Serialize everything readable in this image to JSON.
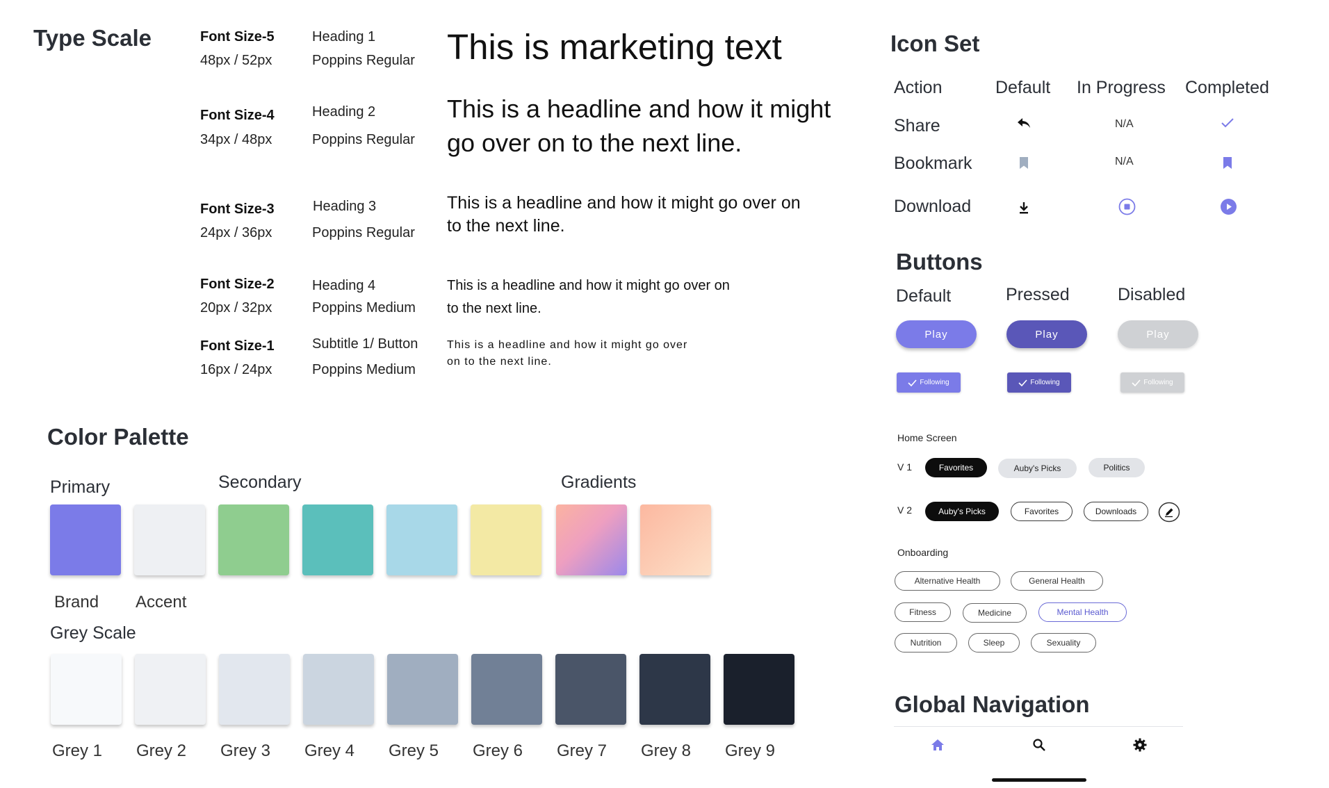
{
  "type_scale": {
    "title": "Type Scale",
    "rows": [
      {
        "size_name": "Font Size-5",
        "size_val": "48px / 52px",
        "heading": "Heading 1",
        "font": "Poppins Regular",
        "sample": "This is marketing text"
      },
      {
        "size_name": "Font Size-4",
        "size_val": "34px / 48px",
        "heading": "Heading 2",
        "font": "Poppins Regular",
        "sample": "This is a headline and how it might go over on to the next line."
      },
      {
        "size_name": "Font Size-3",
        "size_val": "24px / 36px",
        "heading": "Heading 3",
        "font": "Poppins Regular",
        "sample": "This is a headline and how it might go over on to the next line."
      },
      {
        "size_name": "Font Size-2",
        "size_val": "20px / 32px",
        "heading": "Heading 4",
        "font": "Poppins Medium",
        "sample": "This is a headline and how it might go over on to the next line."
      },
      {
        "size_name": "Font Size-1",
        "size_val": "16px / 24px",
        "heading": "Subtitle 1/ Button",
        "font": "Poppins Medium",
        "sample": "This is a headline and how it might go over on to the next line."
      }
    ]
  },
  "color_palette": {
    "title": "Color Palette",
    "primary_title": "Primary",
    "secondary_title": "Secondary",
    "gradients_title": "Gradients",
    "brand_label": "Brand",
    "accent_label": "Accent",
    "colors": {
      "brand": "#7b7be8",
      "accent": "#eef0f3",
      "secondary": [
        "#8fcd8f",
        "#5bbfbb",
        "#a8d8e8",
        "#f3e9a4"
      ],
      "gradient_1": [
        "#fbb3a1",
        "#9b88ea"
      ],
      "gradient_2": [
        "#fcb8a0",
        "#fde0c8"
      ]
    },
    "grey_title": "Grey Scale",
    "greys": [
      {
        "label": "Grey 1",
        "color": "#f7f9fb"
      },
      {
        "label": "Grey 2",
        "color": "#eff1f4"
      },
      {
        "label": "Grey 3",
        "color": "#e2e7ee"
      },
      {
        "label": "Grey 4",
        "color": "#cbd5e0"
      },
      {
        "label": "Grey 5",
        "color": "#a0aec0"
      },
      {
        "label": "Grey 6",
        "color": "#718096"
      },
      {
        "label": "Grey 7",
        "color": "#4a5568"
      },
      {
        "label": "Grey 8",
        "color": "#2d3748"
      },
      {
        "label": "Grey 9",
        "color": "#1a202c"
      }
    ]
  },
  "icon_set": {
    "title": "Icon Set",
    "headers": [
      "Action",
      "Default",
      "In Progress",
      "Completed"
    ],
    "rows": [
      {
        "action": "Share",
        "default_icon": "reply-arrow-icon",
        "in_progress": "N/A",
        "completed_icon": "checkmark-icon"
      },
      {
        "action": "Bookmark",
        "default_icon": "bookmark-icon",
        "in_progress": "N/A",
        "completed_icon": "bookmark-filled-icon"
      },
      {
        "action": "Download",
        "default_icon": "download-icon",
        "in_progress_icon": "stop-circle-icon",
        "completed_icon": "play-circle-icon"
      }
    ]
  },
  "buttons": {
    "title": "Buttons",
    "states": [
      "Default",
      "Pressed",
      "Disabled"
    ],
    "play_label": "Play",
    "following_label": "Following",
    "colors": {
      "default": "#7b7be8",
      "pressed": "#5a57b8",
      "disabled": "#cfd1d4"
    }
  },
  "home_screen": {
    "title": "Home Screen",
    "v1_label": "V 1",
    "v1_chips": [
      "Favorites",
      "Auby's Picks",
      "Politics"
    ],
    "v2_label": "V 2",
    "v2_chips": [
      "Auby's Picks",
      "Favorites",
      "Downloads"
    ],
    "edit_icon": "pencil-icon"
  },
  "onboarding": {
    "title": "Onboarding",
    "chips_row1": [
      "Alternative Health",
      "General Health"
    ],
    "chips_row2": [
      "Fitness",
      "Medicine",
      "Mental Health"
    ],
    "chips_row3": [
      "Nutrition",
      "Sleep",
      "Sexuality"
    ]
  },
  "global_nav": {
    "title": "Global Navigation",
    "icons": [
      "home-icon",
      "search-icon",
      "gear-icon"
    ],
    "active_color": "#7b7be8"
  }
}
